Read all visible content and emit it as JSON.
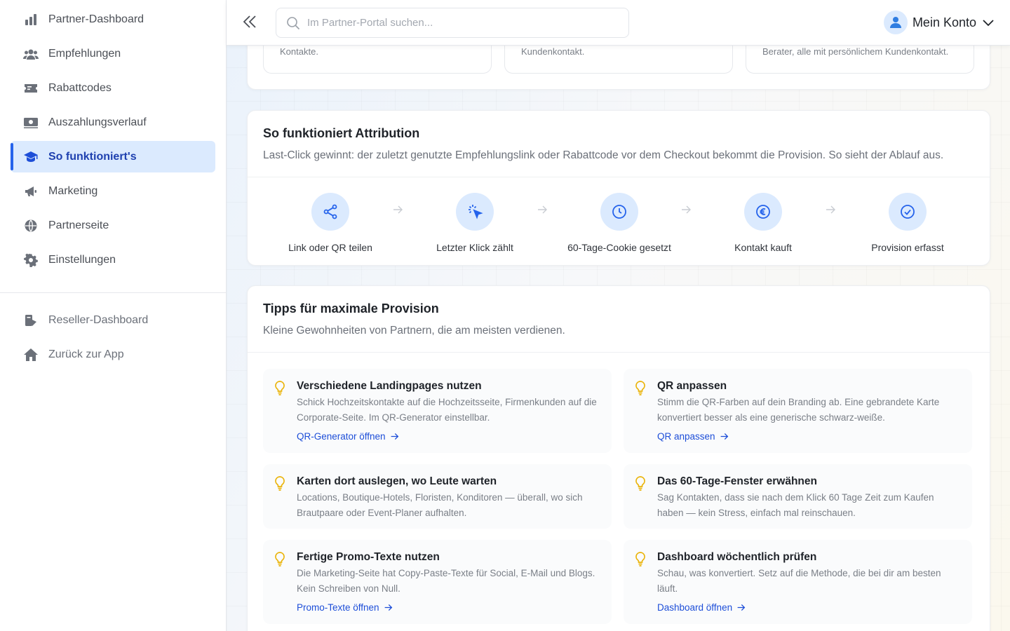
{
  "sidebar": {
    "items": [
      {
        "label": "Partner-Dashboard",
        "icon": "bar-chart-icon"
      },
      {
        "label": "Empfehlungen",
        "icon": "users-icon"
      },
      {
        "label": "Rabattcodes",
        "icon": "ticket-icon"
      },
      {
        "label": "Auszahlungsverlauf",
        "icon": "banknote-icon"
      },
      {
        "label": "So funktioniert's",
        "icon": "graduation-cap-icon",
        "active": true
      },
      {
        "label": "Marketing",
        "icon": "megaphone-icon"
      },
      {
        "label": "Partnerseite",
        "icon": "globe-icon"
      },
      {
        "label": "Einstellungen",
        "icon": "gear-icon"
      }
    ],
    "secondary": [
      {
        "label": "Reseller-Dashboard",
        "icon": "reseller-icon"
      },
      {
        "label": "Zurück zur App",
        "icon": "home-icon"
      }
    ]
  },
  "topbar": {
    "search_placeholder": "Im Partner-Portal suchen...",
    "account_label": "Mein Konto"
  },
  "top_cards": [
    "Kontakte.",
    "Kundenkontakt.",
    "Berater, alle mit persönlichem Kundenkontakt."
  ],
  "attribution": {
    "title": "So funktioniert Attribution",
    "subtitle": "Last-Click gewinnt: der zuletzt genutzte Empfehlungslink oder Rabattcode vor dem Checkout bekommt die Provision. So sieht der Ablauf aus.",
    "steps": [
      {
        "label": "Link oder QR teilen",
        "icon": "share-icon"
      },
      {
        "label": "Letzter Klick zählt",
        "icon": "cursor-click-icon"
      },
      {
        "label": "60-Tage-Cookie gesetzt",
        "icon": "clock-icon"
      },
      {
        "label": "Kontakt kauft",
        "icon": "euro-icon"
      },
      {
        "label": "Provision erfasst",
        "icon": "check-circle-icon"
      }
    ]
  },
  "tips": {
    "title": "Tipps für maximale Provision",
    "subtitle": "Kleine Gewohnheiten von Partnern, die am meisten verdienen.",
    "items": [
      {
        "title": "Verschiedene Landingpages nutzen",
        "text": "Schick Hochzeitskontakte auf die Hochzeitsseite, Firmenkunden auf die Corporate-Seite. Im QR-Generator einstellbar.",
        "link": "QR-Generator öffnen"
      },
      {
        "title": "QR anpassen",
        "text": "Stimm die QR-Farben auf dein Branding ab. Eine gebrandete Karte konvertiert besser als eine generische schwarz-weiße.",
        "link": "QR anpassen"
      },
      {
        "title": "Karten dort auslegen, wo Leute warten",
        "text": "Locations, Boutique-Hotels, Floristen, Konditoren — überall, wo sich Brautpaare oder Event-Planer aufhalten.",
        "link": ""
      },
      {
        "title": "Das 60-Tage-Fenster erwähnen",
        "text": "Sag Kontakten, dass sie nach dem Klick 60 Tage Zeit zum Kaufen haben — kein Stress, einfach mal reinschauen.",
        "link": ""
      },
      {
        "title": "Fertige Promo-Texte nutzen",
        "text": "Die Marketing-Seite hat Copy-Paste-Texte für Social, E-Mail und Blogs. Kein Schreiben von Null.",
        "link": "Promo-Texte öffnen"
      },
      {
        "title": "Dashboard wöchentlich prüfen",
        "text": "Schau, was konvertiert. Setz auf die Methode, die bei dir am besten läuft.",
        "link": "Dashboard öffnen"
      }
    ]
  },
  "colors": {
    "accent": "#2563eb",
    "active_bg": "#dbeafe",
    "bulb": "#eab308"
  }
}
